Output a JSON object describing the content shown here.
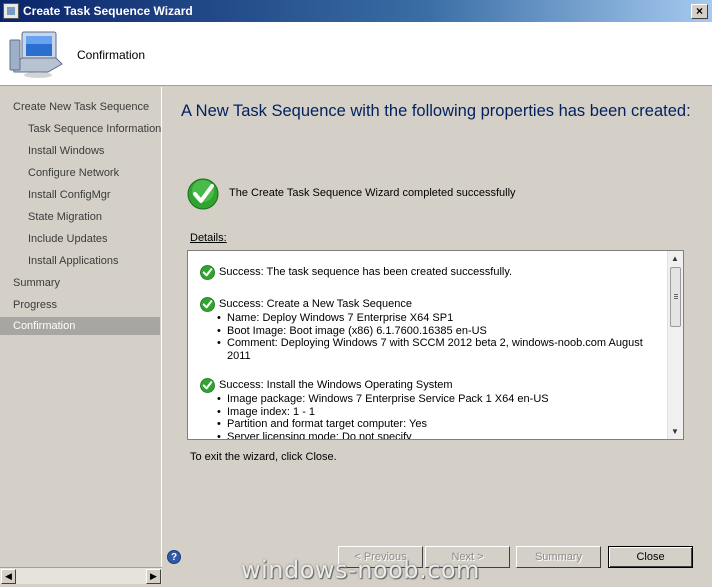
{
  "window": {
    "title": "Create Task Sequence Wizard",
    "close_glyph": "×"
  },
  "header": {
    "title": "Confirmation",
    "icon": "computer-icon"
  },
  "nav": {
    "items": [
      {
        "label": "Create New Task Sequence",
        "indent": 0,
        "selected": false
      },
      {
        "label": "Task Sequence Information",
        "indent": 1,
        "selected": false
      },
      {
        "label": "Install Windows",
        "indent": 1,
        "selected": false
      },
      {
        "label": "Configure Network",
        "indent": 1,
        "selected": false
      },
      {
        "label": "Install ConfigMgr",
        "indent": 1,
        "selected": false
      },
      {
        "label": "State Migration",
        "indent": 1,
        "selected": false
      },
      {
        "label": "Include Updates",
        "indent": 1,
        "selected": false
      },
      {
        "label": "Install Applications",
        "indent": 1,
        "selected": false
      },
      {
        "label": "Summary",
        "indent": 0,
        "selected": false
      },
      {
        "label": "Progress",
        "indent": 0,
        "selected": false
      },
      {
        "label": "Confirmation",
        "indent": 0,
        "selected": true
      }
    ]
  },
  "main": {
    "heading": "A New Task Sequence with the following properties has been created:",
    "success_message": "The Create Task Sequence Wizard completed successfully",
    "details_label": "Details:",
    "details": [
      {
        "title": "Success: The task sequence has been created successfully.",
        "bullets": []
      },
      {
        "title": "Success: Create a New Task Sequence",
        "bullets": [
          "Name: Deploy Windows 7 Enterprise X64 SP1",
          "Boot Image: Boot image (x86) 6.1.7600.16385 en-US",
          "Comment: Deploying Windows 7 with SCCM 2012 beta 2, windows-noob.com August 2011"
        ]
      },
      {
        "title": "Success: Install the Windows Operating System",
        "bullets": [
          "Image package: Windows 7 Enterprise Service Pack 1 X64 en-US",
          "Image index: 1 - 1",
          "Partition and format target computer: Yes",
          "Server licensing mode: Do not specify"
        ]
      }
    ],
    "exit_text": "To exit the wizard, click Close."
  },
  "buttons": {
    "previous": "< Previous",
    "next": "Next >",
    "summary": "Summary",
    "close": "Close",
    "help": "?"
  },
  "watermark": "windows-noob.com",
  "colors": {
    "heading": "#00215e",
    "nav_selected": "#a7a6a2",
    "check_green": "#2fa52f"
  }
}
